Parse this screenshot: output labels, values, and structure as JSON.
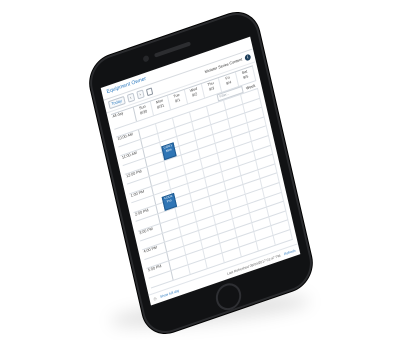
{
  "app": {
    "title": "Equipment Owner"
  },
  "toolbar": {
    "today_label": "Today",
    "prev_label": "‹",
    "next_label": "›",
    "device_name": "Minister Series Content"
  },
  "calendar": {
    "all_day_label": "All day",
    "days": [
      {
        "name": "Sun",
        "date": "8/30"
      },
      {
        "name": "Mon",
        "date": "8/31"
      },
      {
        "name": "Tue",
        "date": "9/1"
      },
      {
        "name": "Wed",
        "date": "9/2"
      },
      {
        "name": "Thu",
        "date": "9/3"
      },
      {
        "name": "Fri",
        "date": "9/4"
      },
      {
        "name": "Sat",
        "date": "9/5"
      }
    ],
    "filter_placeholder": "Filter...",
    "view_label": "Week",
    "times": [
      "10:00 AM",
      "",
      "11:00 AM",
      "",
      "12:00 PM",
      "",
      "1:00 PM",
      "",
      "2:00 PM",
      "",
      "3:00 PM",
      "",
      "4:00 PM",
      "",
      "5:00 PM",
      ""
    ],
    "events": [
      {
        "label": "CDD1 Mini"
      },
      {
        "label": "CDD1 Pro"
      }
    ]
  },
  "footer": {
    "show_full_day": "Show full day",
    "last_refreshed": "Last Refreshed 09/04/2017 01:47 PM",
    "refresh": "Refresh"
  }
}
